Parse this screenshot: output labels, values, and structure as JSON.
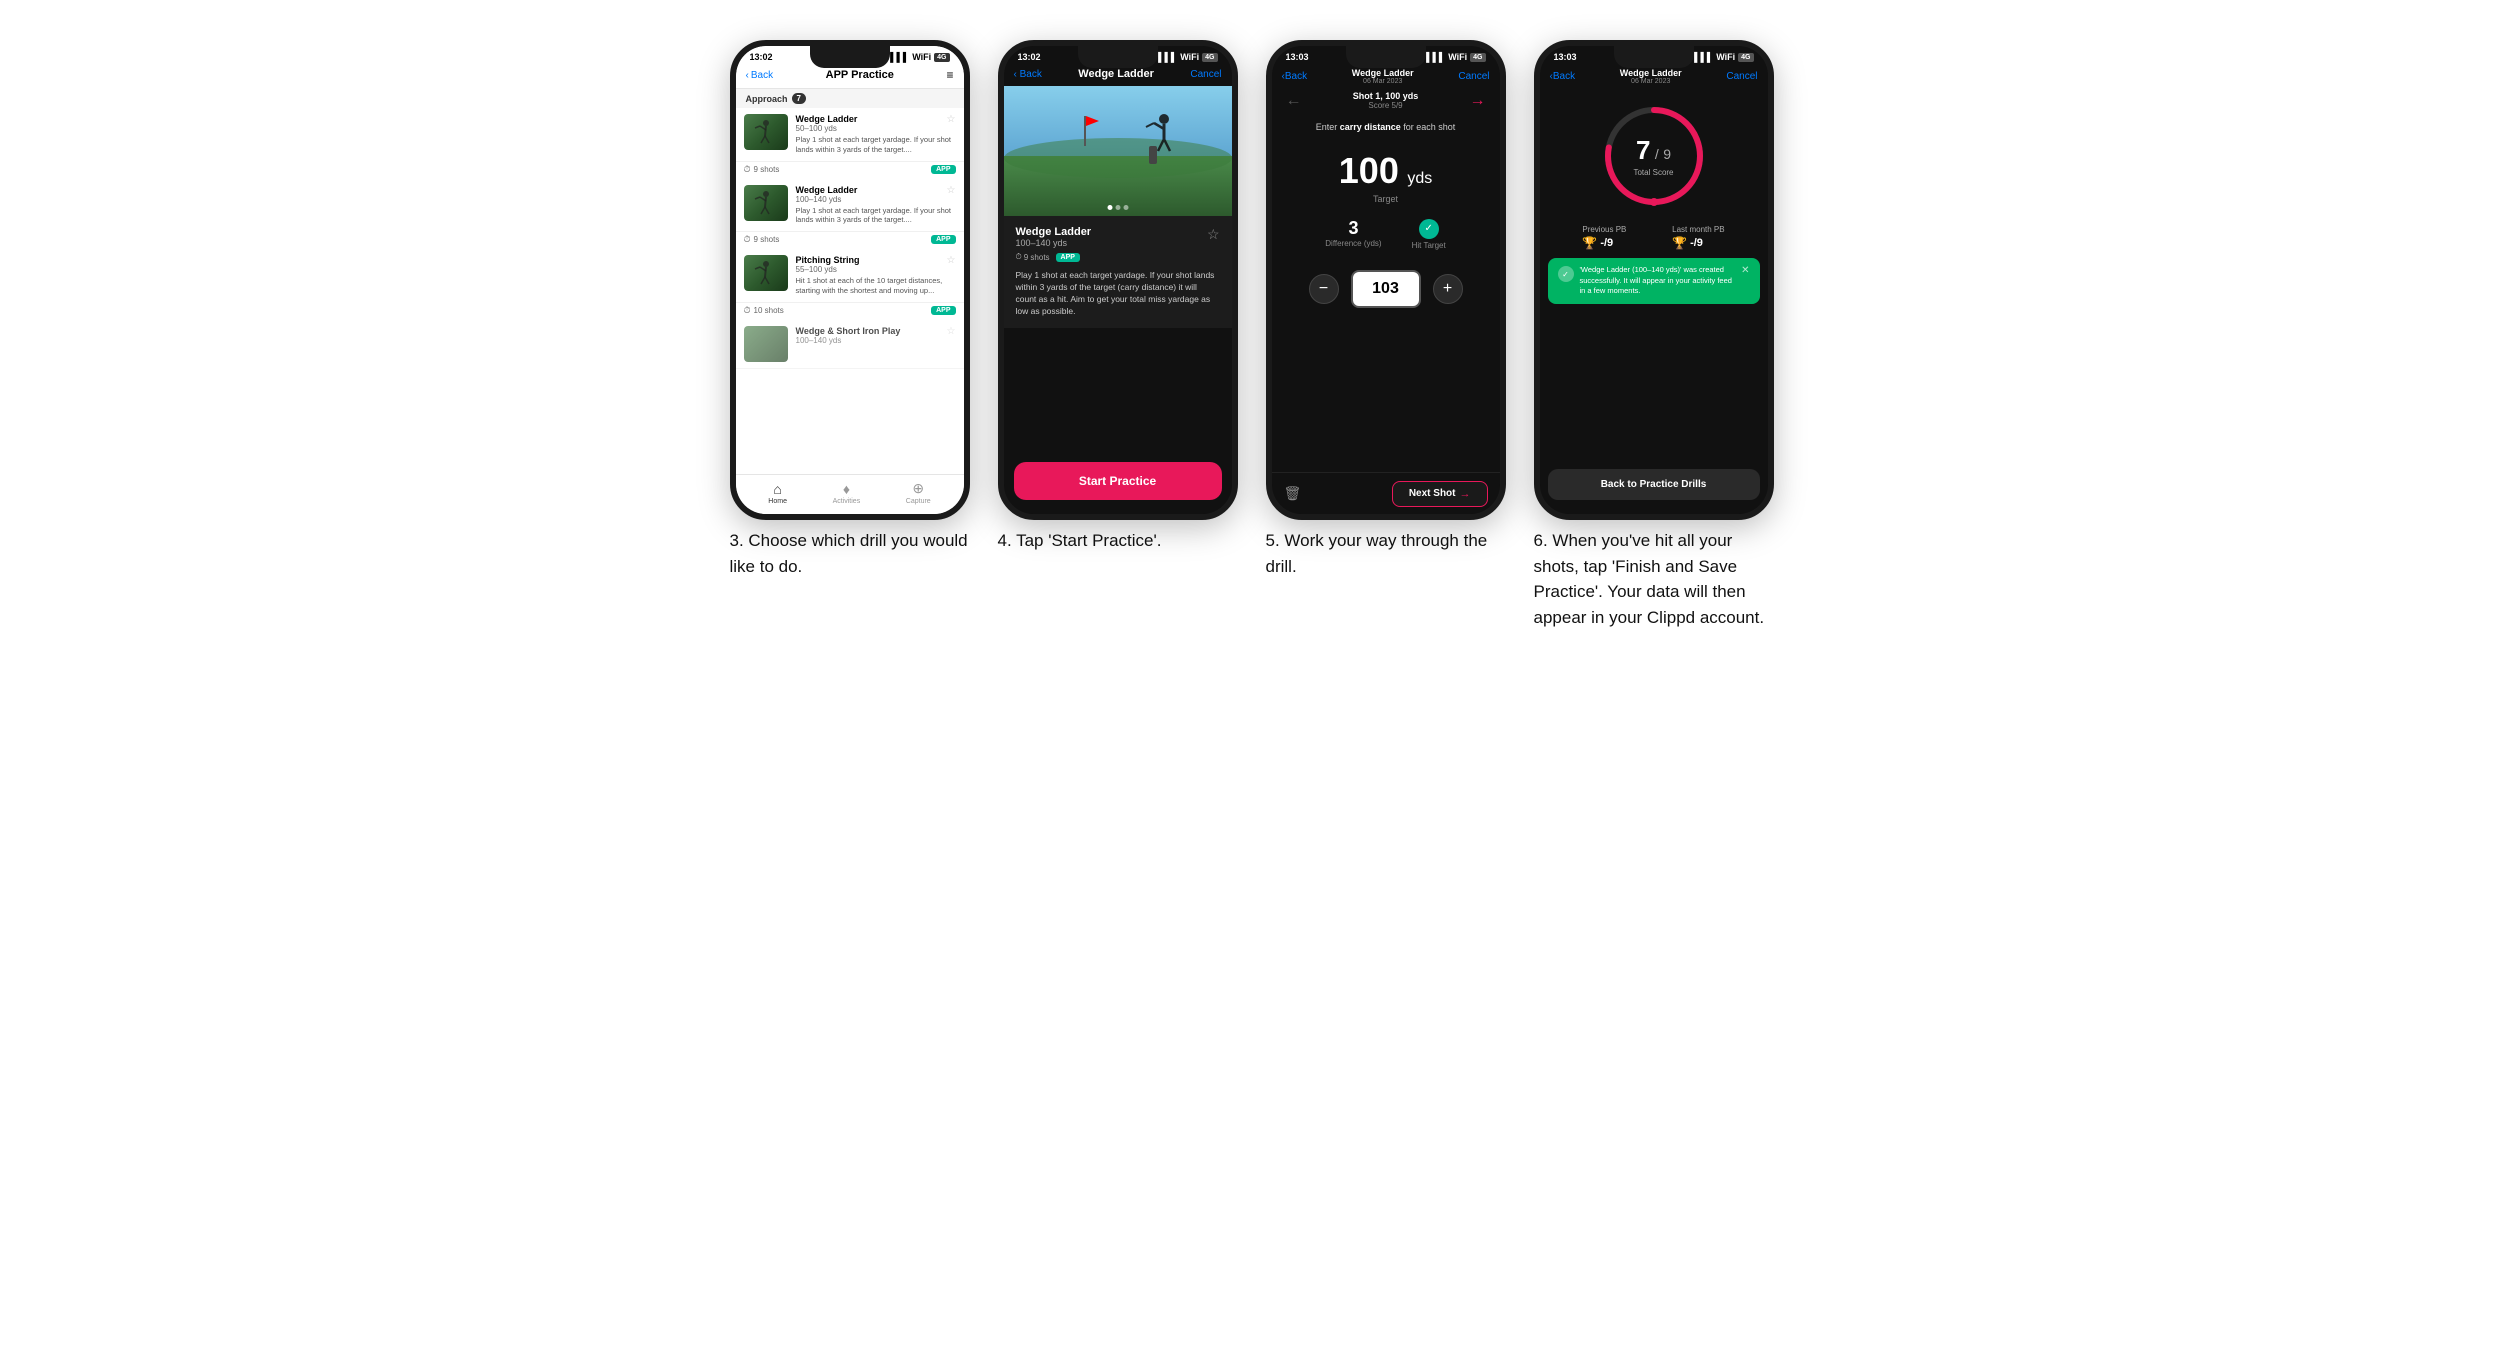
{
  "phones": [
    {
      "id": "phone3",
      "status_time": "13:02",
      "nav": {
        "back": "Back",
        "title": "APP Practice",
        "menu": "≡"
      },
      "category": "Approach",
      "category_count": "7",
      "drills": [
        {
          "name": "Wedge Ladder",
          "yds": "50–100 yds",
          "desc": "Play 1 shot at each target yardage. If your shot lands within 3 yards of the target....",
          "shots": "9 shots",
          "badge": "APP"
        },
        {
          "name": "Wedge Ladder",
          "yds": "100–140 yds",
          "desc": "Play 1 shot at each target yardage. If your shot lands within 3 yards of the target....",
          "shots": "9 shots",
          "badge": "APP"
        },
        {
          "name": "Pitching String",
          "yds": "55–100 yds",
          "desc": "Hit 1 shot at each of the 10 target distances, starting with the shortest and moving up...",
          "shots": "10 shots",
          "badge": "APP"
        },
        {
          "name": "Wedge & Short Iron Play",
          "yds": "100–140 yds",
          "desc": "",
          "shots": "",
          "badge": ""
        }
      ],
      "tabs": [
        "Home",
        "Activities",
        "Capture"
      ],
      "caption": "3. Choose which drill you would like to do."
    },
    {
      "id": "phone4",
      "status_time": "13:02",
      "nav": {
        "back": "Back",
        "title": "Wedge Ladder",
        "cancel": "Cancel"
      },
      "drill": {
        "name": "Wedge Ladder",
        "yds": "100–140 yds",
        "shots": "9 shots",
        "badge": "APP",
        "desc": "Play 1 shot at each target yardage. If your shot lands within 3 yards of the target (carry distance) it will count as a hit. Aim to get your total miss yardage as low as possible."
      },
      "start_btn": "Start Practice",
      "caption": "4. Tap 'Start Practice'."
    },
    {
      "id": "phone5",
      "status_time": "13:03",
      "nav": {
        "back": "Back",
        "title_main": "Wedge Ladder",
        "title_sub": "06 Mar 2023",
        "cancel": "Cancel"
      },
      "shot": {
        "num": "Shot 1, 100 yds",
        "score": "Score 5/9"
      },
      "instruction": "Enter carry distance for each shot",
      "target_yds": "100",
      "target_unit": "yds",
      "target_label": "Target",
      "difference": "3",
      "difference_label": "Difference (yds)",
      "hit_target_label": "Hit Target",
      "input_value": "103",
      "next_shot_label": "Next Shot",
      "caption": "5. Work your way through the drill."
    },
    {
      "id": "phone6",
      "status_time": "13:03",
      "nav": {
        "back": "Back",
        "title_main": "Wedge Ladder",
        "title_sub": "06 Mar 2023",
        "cancel": "Cancel"
      },
      "score": "7",
      "score_total": "9",
      "score_label": "Total Score",
      "previous_pb_label": "Previous PB",
      "previous_pb_value": "-/9",
      "last_month_pb_label": "Last month PB",
      "last_month_pb_value": "-/9",
      "toast_text": "'Wedge Ladder (100–140 yds)' was created successfully. It will appear in your activity feed in a few moments.",
      "back_btn": "Back to Practice Drills",
      "caption": "6. When you've hit all your shots, tap 'Finish and Save Practice'. Your data will then appear in your Clippd account."
    }
  ]
}
